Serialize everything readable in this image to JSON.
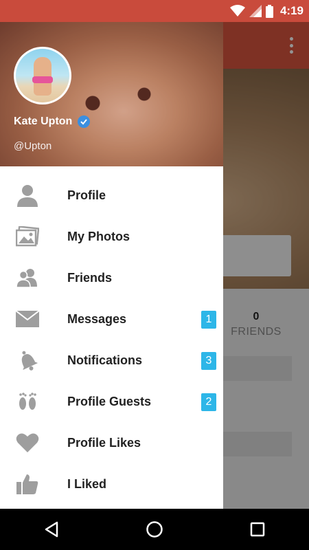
{
  "status_bar": {
    "time": "4:19",
    "icons": [
      "wifi-icon",
      "signal-icon",
      "battery-icon"
    ]
  },
  "background": {
    "friends_count": "0",
    "friends_label": "FRIENDS"
  },
  "drawer": {
    "user_name": "Kate Upton",
    "handle": "@Upton",
    "items": [
      {
        "label": "Profile",
        "icon": "person-icon",
        "badge": ""
      },
      {
        "label": "My Photos",
        "icon": "photos-icon",
        "badge": ""
      },
      {
        "label": "Friends",
        "icon": "friends-icon",
        "badge": ""
      },
      {
        "label": "Messages",
        "icon": "envelope-icon",
        "badge": "1"
      },
      {
        "label": "Notifications",
        "icon": "bell-icon",
        "badge": "3"
      },
      {
        "label": "Profile Guests",
        "icon": "footprints-icon",
        "badge": "2"
      },
      {
        "label": "Profile Likes",
        "icon": "heart-icon",
        "badge": ""
      },
      {
        "label": "I Liked",
        "icon": "thumbs-up-icon",
        "badge": ""
      }
    ]
  },
  "colors": {
    "status_bar": "#c94b3c",
    "badge": "#2db6e8",
    "icon_gray": "#9e9e9e",
    "verified": "#3a8fe0"
  },
  "nav_bar": {
    "icons": [
      "back-icon",
      "home-icon",
      "recents-icon"
    ]
  }
}
